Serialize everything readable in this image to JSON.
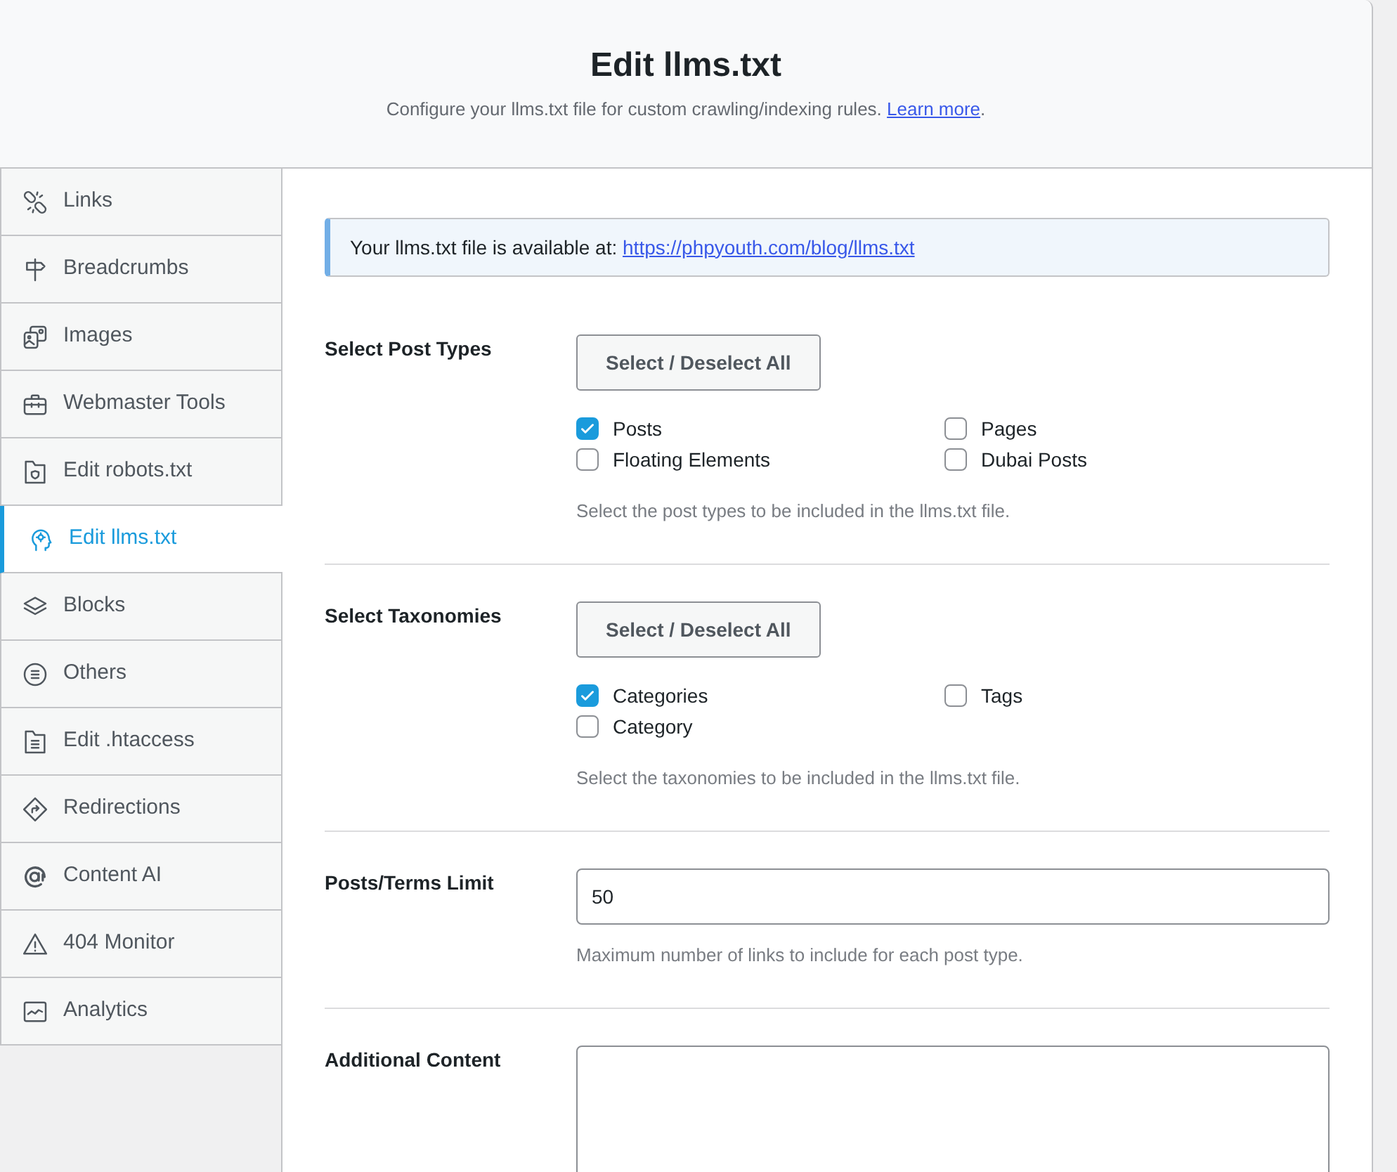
{
  "header": {
    "title": "Edit llms.txt",
    "subtitle": "Configure your llms.txt file for custom crawling/indexing rules.",
    "link": "Learn more",
    "link_suffix": "."
  },
  "sidebar": {
    "items": [
      {
        "label": "Links",
        "selected": false
      },
      {
        "label": "Breadcrumbs",
        "selected": false
      },
      {
        "label": "Images",
        "selected": false
      },
      {
        "label": "Webmaster Tools",
        "selected": false
      },
      {
        "label": "Edit robots.txt",
        "selected": false
      },
      {
        "label": "Edit llms.txt",
        "selected": true
      },
      {
        "label": "Blocks",
        "selected": false
      },
      {
        "label": "Others",
        "selected": false
      },
      {
        "label": "Edit .htaccess",
        "selected": false
      },
      {
        "label": "Redirections",
        "selected": false
      },
      {
        "label": "Content AI",
        "selected": false
      },
      {
        "label": "404 Monitor",
        "selected": false
      },
      {
        "label": "Analytics",
        "selected": false
      }
    ]
  },
  "notice": {
    "text": "Your llms.txt file is available at:",
    "link": "https://phpyouth.com/blog/llms.txt"
  },
  "sections": [
    {
      "kind": "checkbox_group",
      "label": "Select Post Types",
      "button": "Select / Deselect All",
      "options": [
        {
          "label": "Posts",
          "checked": true
        },
        {
          "label": "Pages",
          "checked": false
        },
        {
          "label": "Floating Elements",
          "checked": false
        },
        {
          "label": "Dubai Posts",
          "checked": false
        }
      ],
      "description": "Select the post types to be included in the llms.txt file."
    },
    {
      "kind": "checkbox_group",
      "label": "Select Taxonomies",
      "button": "Select / Deselect All",
      "options": [
        {
          "label": "Categories",
          "checked": true
        },
        {
          "label": "Tags",
          "checked": false
        },
        {
          "label": "Category",
          "checked": false
        }
      ],
      "description": "Select the taxonomies to be included in the llms.txt file."
    },
    {
      "kind": "number_field",
      "label": "Posts/Terms Limit",
      "value": "50",
      "description": "Maximum number of links to include for each post type."
    },
    {
      "kind": "text_area",
      "label": "Additional Content"
    }
  ]
}
